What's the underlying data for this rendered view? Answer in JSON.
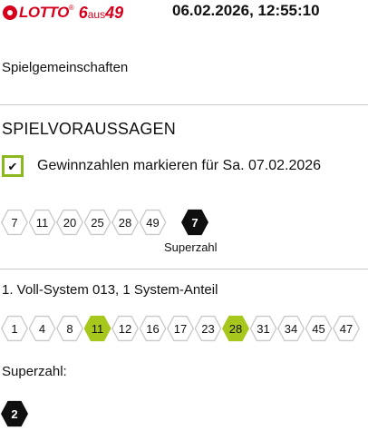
{
  "header": {
    "logo": {
      "lotto": "LOTTO",
      "registered": "®",
      "six": "6",
      "aus": "aus",
      "fortynine": "49"
    },
    "datetime": "06.02.2026, 12:55:10"
  },
  "community_link": "Spielgemeinschaften",
  "section_title": "SPIELVORAUSSAGEN",
  "highlight_option": {
    "checked": true,
    "label": "Gewinnzahlen markieren für Sa. 07.02.2026"
  },
  "winning_numbers": [
    "7",
    "11",
    "20",
    "25",
    "28",
    "49"
  ],
  "winning_superzahl": "7",
  "superzahl_caption": "Superzahl",
  "system_ticket": {
    "title": "1. Voll-System 013, 1 System-Anteil",
    "numbers": [
      {
        "value": "1",
        "match": false
      },
      {
        "value": "4",
        "match": false
      },
      {
        "value": "8",
        "match": false
      },
      {
        "value": "11",
        "match": true
      },
      {
        "value": "12",
        "match": false
      },
      {
        "value": "16",
        "match": false
      },
      {
        "value": "17",
        "match": false
      },
      {
        "value": "23",
        "match": false
      },
      {
        "value": "28",
        "match": true
      },
      {
        "value": "31",
        "match": false
      },
      {
        "value": "34",
        "match": false
      },
      {
        "value": "45",
        "match": false
      },
      {
        "value": "47",
        "match": false
      }
    ],
    "superzahl_label": "Superzahl:",
    "superzahl": "2"
  },
  "colors": {
    "brand_red": "#d6001c",
    "match_green": "#a6c81d",
    "dark": "#0f0f0f",
    "divider": "#c8c8c8"
  }
}
